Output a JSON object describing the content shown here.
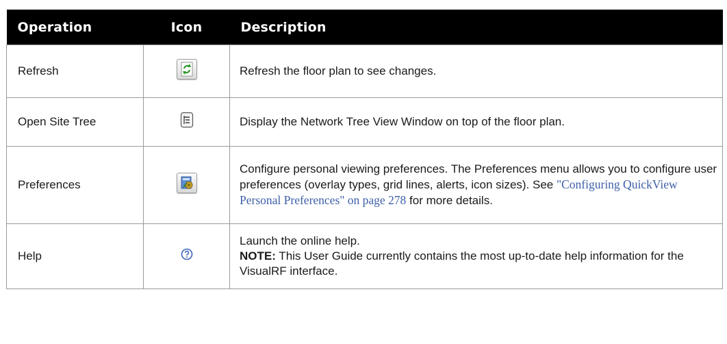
{
  "table": {
    "headers": {
      "operation": "Operation",
      "icon": "Icon",
      "description": "Description"
    },
    "rows": [
      {
        "operation": "Refresh",
        "icon": "refresh-icon",
        "description": "Refresh the floor plan to see changes."
      },
      {
        "operation": "Open Site Tree",
        "icon": "site-tree-icon",
        "description": "Display the Network Tree View Window on top of the floor plan."
      },
      {
        "operation": "Preferences",
        "icon": "preferences-icon",
        "description_lead": "Configure personal viewing preferences. The Preferences menu allows you to configure user preferences (overlay types, grid lines, alerts, icon sizes). See ",
        "link": "\"Configuring QuickView Personal Preferences\" on page 278",
        "description_tail": " for more details."
      },
      {
        "operation": "Help",
        "icon": "help-icon",
        "description_line1": "Launch the online help.",
        "note_label": "NOTE:",
        "note_text": " This User Guide currently contains the most up-to-date help information for the VisualRF interface."
      }
    ]
  },
  "colors": {
    "header_bg": "#000000",
    "header_text": "#ffffff",
    "link": "#3c5fa8",
    "border": "#9a9a9a"
  }
}
